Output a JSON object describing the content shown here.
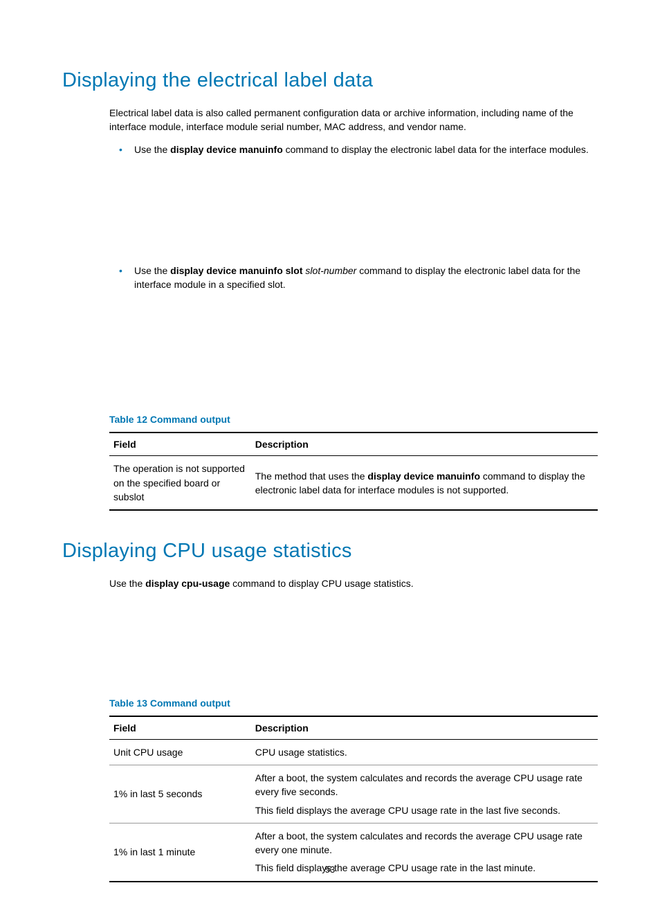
{
  "sections": [
    {
      "heading": "Displaying the electrical label data",
      "intro": "Electrical label data is also called permanent configuration data or archive information, including name of the interface module, interface module serial number, MAC address, and vendor name.",
      "bullets": [
        {
          "prefix": "Use the ",
          "bold": "display device manuinfo",
          "italic": "",
          "after": " command to display the electronic label data for the interface modules."
        },
        {
          "prefix": "Use the ",
          "bold": "display device manuinfo slot",
          "italic": " slot-number",
          "after": " command to display the electronic label data for the interface module in a specified slot."
        }
      ],
      "table": {
        "caption": "Table 12 Command output",
        "headers": [
          "Field",
          "Description"
        ],
        "rows": [
          {
            "field": "The operation is not supported on the specified board or subslot",
            "desc_pre": "The method that uses the ",
            "desc_bold": "display device manuinfo",
            "desc_post": " command to display the electronic label data for interface modules is not supported.",
            "desc_extra": ""
          }
        ]
      }
    },
    {
      "heading": "Displaying CPU usage statistics",
      "para_pre": "Use the ",
      "para_bold": "display cpu-usage",
      "para_post": " command to display CPU usage statistics.",
      "table": {
        "caption": "Table 13 Command output",
        "headers": [
          "Field",
          "Description"
        ],
        "rows": [
          {
            "field": "Unit CPU usage",
            "desc_pre": "",
            "desc_bold": "",
            "desc_post": "CPU usage statistics.",
            "desc_extra": ""
          },
          {
            "field": "1% in last 5 seconds",
            "desc_pre": "",
            "desc_bold": "",
            "desc_post": "After a boot, the system calculates and records the average CPU usage rate every five seconds.",
            "desc_extra": "This field displays the average CPU usage rate in the last five seconds."
          },
          {
            "field": "1% in last 1 minute",
            "desc_pre": "",
            "desc_bold": "",
            "desc_post": "After a boot, the system calculates and records the average CPU usage rate every one minute.",
            "desc_extra": "This field displays the average CPU usage rate in the last minute."
          }
        ]
      }
    }
  ],
  "page_number": "53"
}
